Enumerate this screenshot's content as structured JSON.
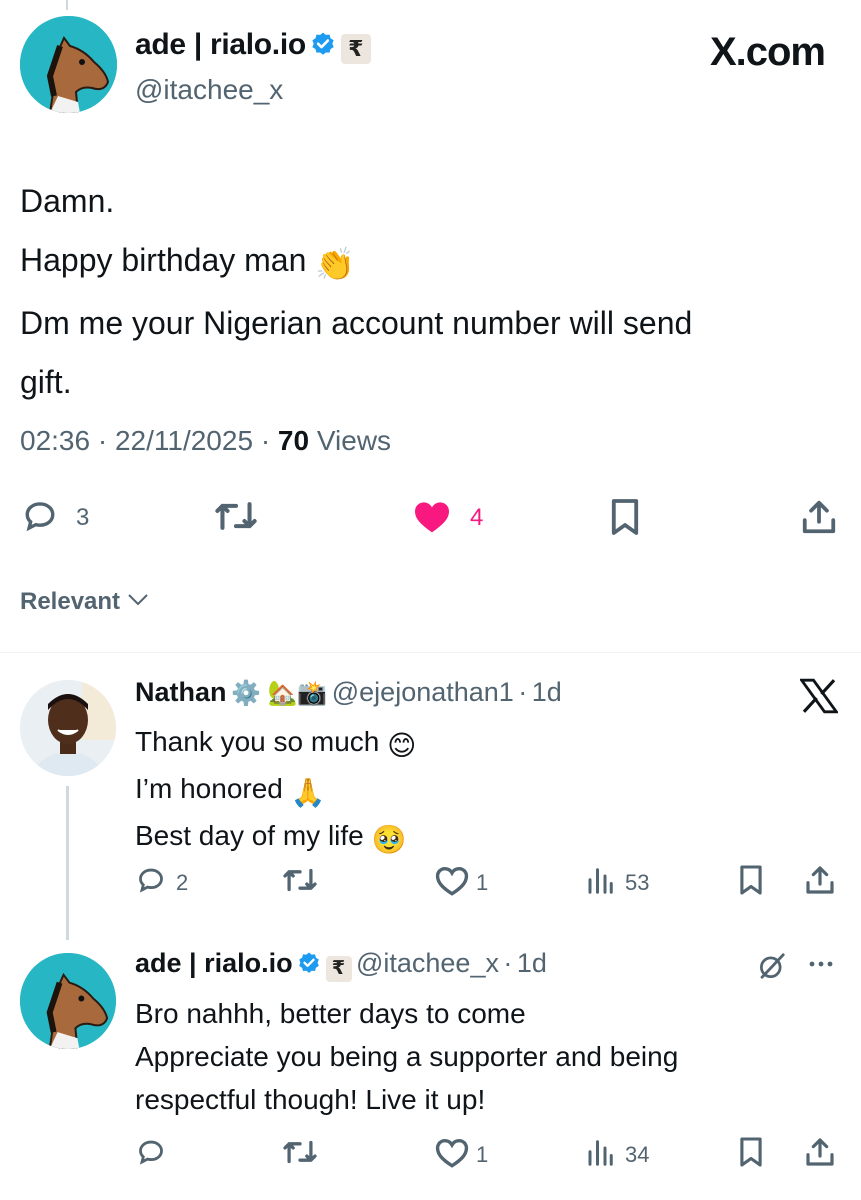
{
  "main_tweet": {
    "author_name": "ade | rialo.io",
    "badge_glyph": "₹",
    "handle": "@itachee_x",
    "source_logo": "X.com",
    "lines": [
      "Damn.",
      "Happy birthday man",
      "Dm me your Nigerian account number will send",
      "gift."
    ],
    "clap_emoji": "👏",
    "time": "02:36",
    "date": "22/11/2025",
    "views_count": "70",
    "views_label": "Views",
    "sep": "·",
    "replies": "3",
    "likes": "4",
    "liked_color": "#f91880"
  },
  "filter": {
    "label": "Relevant"
  },
  "replies": [
    {
      "author_name": "Nathan",
      "emojis": "⚙️ 🏡📸",
      "handle": "@ejejonathan1",
      "age": "1d",
      "lines": [
        "Thank you so much",
        "I’m honored",
        "Best day of my life"
      ],
      "line_emojis": [
        "😊",
        "🙏",
        "🥹"
      ],
      "replies": "2",
      "likes": "1",
      "views": "53"
    },
    {
      "author_name": "ade | rialo.io",
      "badge_glyph": "₹",
      "handle": "@itachee_x",
      "age": "1d",
      "lines": [
        "Bro nahhh, better days to come",
        "Appreciate you being a supporter and being",
        "respectful though! Live it up!"
      ],
      "likes": "1",
      "views": "34"
    }
  ],
  "icons": {
    "verified": "verified-badge-icon",
    "reply": "reply-icon",
    "retweet": "retweet-icon",
    "like": "heart-icon",
    "bookmark": "bookmark-icon",
    "share": "share-icon",
    "views": "analytics-icon",
    "more": "more-icon",
    "grok": "grok-icon",
    "x_logo": "x-logo-icon",
    "chevron": "chevron-down-icon"
  },
  "colors": {
    "verified_blue": "#1d9bf0",
    "muted_text": "#536471",
    "like_pink": "#f91880",
    "avatar_teal": "#27b7c4"
  }
}
